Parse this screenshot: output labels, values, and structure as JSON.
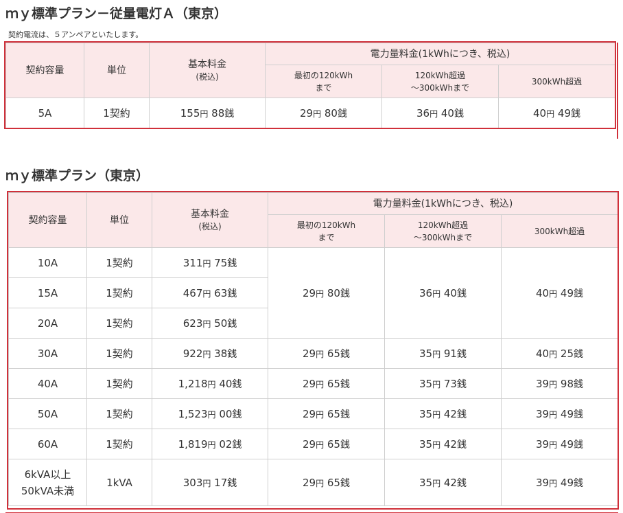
{
  "plan_a": {
    "title": "ｍｙ標準プラン－従量電灯Ａ（東京）",
    "note": "契約電流は、５アンペアといたします。",
    "headers": {
      "capacity": "契約容量",
      "unit": "単位",
      "basic_line1": "基本料金",
      "basic_line2": "(税込)",
      "energy": "電力量料金(1kWhにつき、税込)",
      "tier1_line1": "最初の120kWh",
      "tier1_line2": "まで",
      "tier2_line1": "120kWh超過",
      "tier2_line2": "～300kWhまで",
      "tier3": "300kWh超過"
    },
    "rows": [
      {
        "capacity": "5A",
        "unit": "1契約",
        "basic": {
          "yen": "155",
          "sen": "88"
        },
        "tier1": {
          "yen": "29",
          "sen": "80"
        },
        "tier2": {
          "yen": "36",
          "sen": "40"
        },
        "tier3": {
          "yen": "40",
          "sen": "49"
        }
      }
    ]
  },
  "plan_b": {
    "title": "ｍｙ標準プラン（東京）",
    "headers": {
      "capacity": "契約容量",
      "unit": "単位",
      "basic_line1": "基本料金",
      "basic_line2": "(税込)",
      "energy": "電力量料金(1kWhにつき、税込)",
      "tier1_line1": "最初の120kWh",
      "tier1_line2": "まで",
      "tier2_line1": "120kWh超過",
      "tier2_line2": "～300kWhまで",
      "tier3": "300kWh超過"
    },
    "rows": [
      {
        "capacity": "10A",
        "unit": "1契約",
        "basic": {
          "yen": "311",
          "sen": "75"
        }
      },
      {
        "capacity": "15A",
        "unit": "1契約",
        "basic": {
          "yen": "467",
          "sen": "63"
        }
      },
      {
        "capacity": "20A",
        "unit": "1契約",
        "basic": {
          "yen": "623",
          "sen": "50"
        }
      },
      {
        "capacity": "30A",
        "unit": "1契約",
        "basic": {
          "yen": "922",
          "sen": "38"
        },
        "tier1": {
          "yen": "29",
          "sen": "65"
        },
        "tier2": {
          "yen": "35",
          "sen": "91"
        },
        "tier3": {
          "yen": "40",
          "sen": "25"
        }
      },
      {
        "capacity": "40A",
        "unit": "1契約",
        "basic": {
          "yen": "1,218",
          "sen": "40"
        },
        "tier1": {
          "yen": "29",
          "sen": "65"
        },
        "tier2": {
          "yen": "35",
          "sen": "73"
        },
        "tier3": {
          "yen": "39",
          "sen": "98"
        }
      },
      {
        "capacity": "50A",
        "unit": "1契約",
        "basic": {
          "yen": "1,523",
          "sen": "00"
        },
        "tier1": {
          "yen": "29",
          "sen": "65"
        },
        "tier2": {
          "yen": "35",
          "sen": "42"
        },
        "tier3": {
          "yen": "39",
          "sen": "49"
        }
      },
      {
        "capacity": "60A",
        "unit": "1契約",
        "basic": {
          "yen": "1,819",
          "sen": "02"
        },
        "tier1": {
          "yen": "29",
          "sen": "65"
        },
        "tier2": {
          "yen": "35",
          "sen": "42"
        },
        "tier3": {
          "yen": "39",
          "sen": "49"
        }
      },
      {
        "capacity_line1": "6kVA以上",
        "capacity_line2": "50kVA未満",
        "unit": "1kVA",
        "basic": {
          "yen": "303",
          "sen": "17"
        },
        "tier1": {
          "yen": "29",
          "sen": "65"
        },
        "tier2": {
          "yen": "35",
          "sen": "42"
        },
        "tier3": {
          "yen": "39",
          "sen": "49"
        }
      }
    ],
    "shared_small": {
      "tier1": {
        "yen": "29",
        "sen": "80"
      },
      "tier2": {
        "yen": "36",
        "sen": "40"
      },
      "tier3": {
        "yen": "40",
        "sen": "49"
      }
    }
  },
  "labels": {
    "yen": "円",
    "sen": "銭"
  },
  "colors": {
    "border_accent": "#d0303a",
    "header_bg": "#fbe8e9"
  }
}
